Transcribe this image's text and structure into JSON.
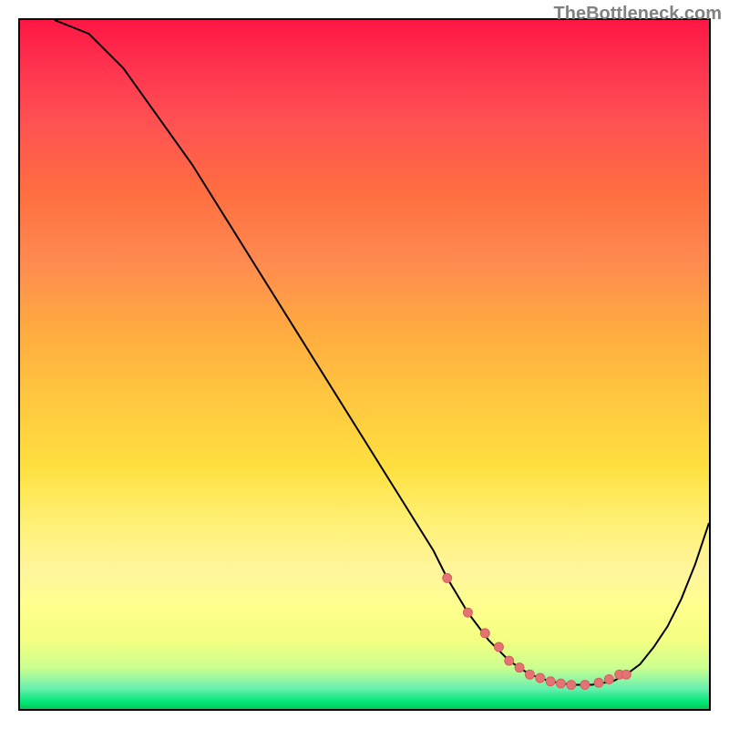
{
  "watermark": "TheBottleneck.com",
  "chart_data": {
    "type": "line",
    "title": "",
    "xlabel": "",
    "ylabel": "",
    "xlim": [
      0,
      100
    ],
    "ylim": [
      0,
      100
    ],
    "series": [
      {
        "name": "curve",
        "x": [
          5,
          10,
          15,
          20,
          25,
          30,
          35,
          40,
          45,
          50,
          55,
          60,
          62,
          65,
          68,
          71,
          74,
          77,
          80,
          83,
          86,
          88,
          90,
          92,
          94,
          96,
          98,
          100
        ],
        "y": [
          100,
          98,
          93,
          86,
          79,
          71,
          63,
          55,
          47,
          39,
          31,
          23,
          19,
          14,
          10,
          7,
          5,
          4,
          3.5,
          3.5,
          4,
          5,
          6.5,
          9,
          12,
          16,
          21,
          27
        ]
      }
    ],
    "dots": {
      "name": "highlight-dots",
      "x": [
        62,
        65,
        67.5,
        69.5,
        71,
        72.5,
        74,
        75.5,
        77,
        78.5,
        80,
        82,
        84,
        85.5,
        87,
        88
      ],
      "y": [
        19,
        14,
        11,
        9,
        7,
        6,
        5,
        4.5,
        4,
        3.7,
        3.5,
        3.5,
        3.8,
        4.3,
        5,
        5
      ]
    },
    "gradient": {
      "top_color": "#ff1744",
      "mid_color": "#ffe040",
      "bottom_color": "#00c853"
    }
  }
}
